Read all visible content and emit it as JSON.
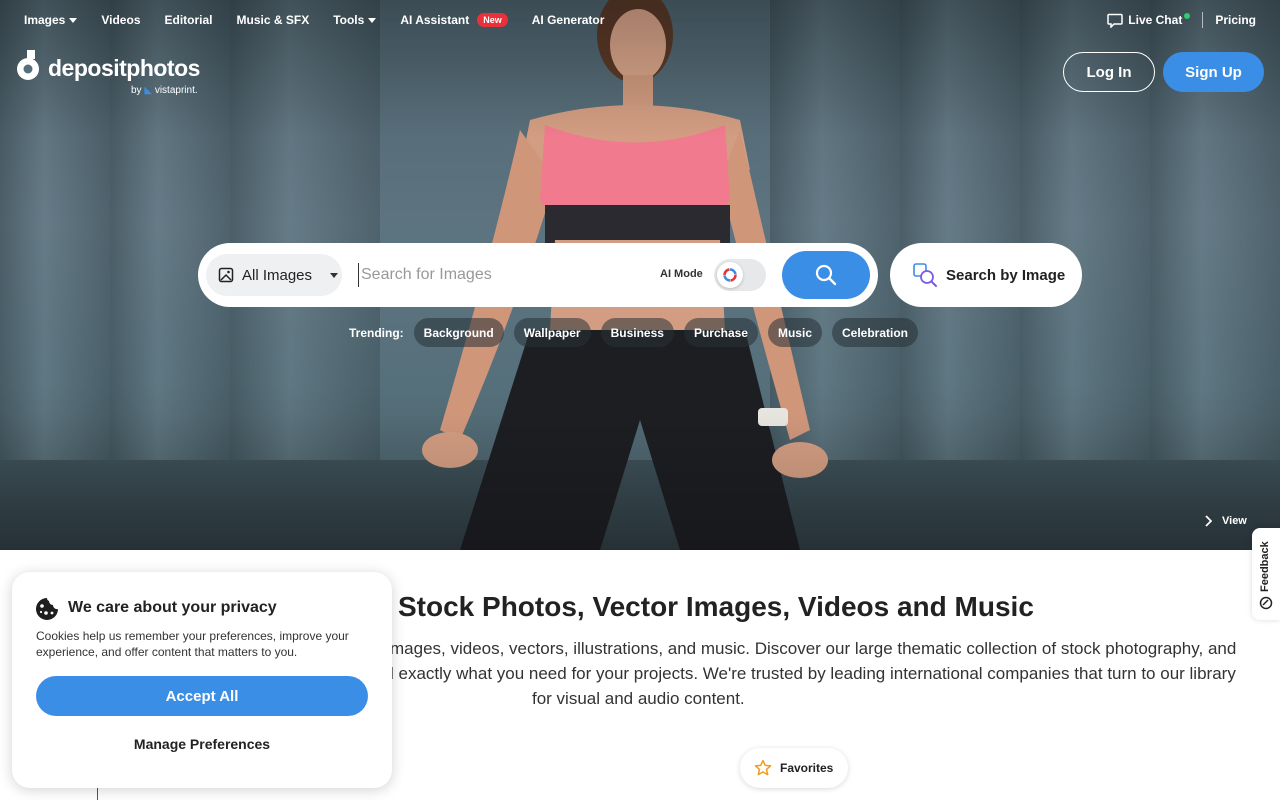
{
  "nav": {
    "items": [
      {
        "label": "Images",
        "dropdown": true
      },
      {
        "label": "Videos"
      },
      {
        "label": "Editorial"
      },
      {
        "label": "Music & SFX"
      },
      {
        "label": "Tools",
        "dropdown": true
      },
      {
        "label": "AI Assistant",
        "badge": "New"
      },
      {
        "label": "AI Generator"
      }
    ],
    "live_chat": "Live Chat",
    "pricing": "Pricing"
  },
  "logo": {
    "name": "depositphotos",
    "by": "by",
    "partner": "vistaprint."
  },
  "auth": {
    "login": "Log In",
    "signup": "Sign Up"
  },
  "search": {
    "category": "All Images",
    "placeholder": "Search for Images",
    "ai_mode": "AI Mode",
    "search_by_image": "Search by Image"
  },
  "trending": {
    "label": "Trending:",
    "tags": [
      "Background",
      "Wallpaper",
      "Business",
      "Purchase",
      "Music",
      "Celebration"
    ]
  },
  "hero": {
    "view": "View"
  },
  "feedback": "Feedback",
  "content": {
    "headline": "Stock Photos, Vector Images, Videos and Music",
    "desc_lines": [
      "mages, videos, vectors, illustrations, and music. Discover our large thematic collection of stock photography, and",
      "l exactly what you need for your projects. We're trusted by leading international companies that turn to our library",
      "for visual and audio content."
    ],
    "favorites": "Favorites"
  },
  "cookie": {
    "title": "We care about your privacy",
    "text": "Cookies help us remember your preferences, improve your experience, and offer content that matters to you.",
    "accept": "Accept All",
    "manage": "Manage Preferences"
  },
  "colors": {
    "accent": "#3b8ee6",
    "badge": "#e9313a",
    "online": "#2ecc71"
  }
}
